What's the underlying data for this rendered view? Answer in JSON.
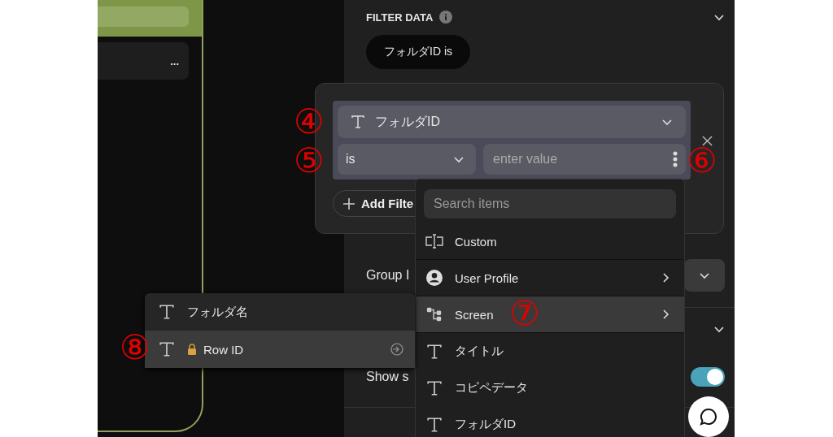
{
  "canvas": {
    "card_menu": "..."
  },
  "panel": {
    "section_title": "FILTER DATA",
    "filter_pill": "フォルダID is",
    "group_label": "Group I",
    "show_label": "Show s",
    "show_toggle": {
      "on": true
    }
  },
  "filter_editor": {
    "field": "フォルダID",
    "operator": "is",
    "value_placeholder": "enter value",
    "add_button": "Add Filte"
  },
  "dropdown": {
    "search_placeholder": "Search items",
    "items": [
      {
        "kind": "custom",
        "label": "Custom",
        "submenu": false,
        "selected": false
      },
      {
        "kind": "profile",
        "label": "User Profile",
        "submenu": true,
        "selected": false
      },
      {
        "kind": "screen",
        "label": "Screen",
        "submenu": true,
        "selected": true
      },
      {
        "kind": "text",
        "label": "タイトル",
        "submenu": false,
        "selected": false
      },
      {
        "kind": "text",
        "label": "コピペデータ",
        "submenu": false,
        "selected": false
      },
      {
        "kind": "text",
        "label": "フォルダID",
        "submenu": false,
        "selected": false
      }
    ]
  },
  "submenu": {
    "items": [
      {
        "label": "フォルダ名",
        "locked": false,
        "selected": false
      },
      {
        "label": "Row ID",
        "locked": true,
        "selected": true
      }
    ]
  },
  "annotations": [
    "④",
    "⑤",
    "⑥",
    "⑦",
    "⑧"
  ]
}
